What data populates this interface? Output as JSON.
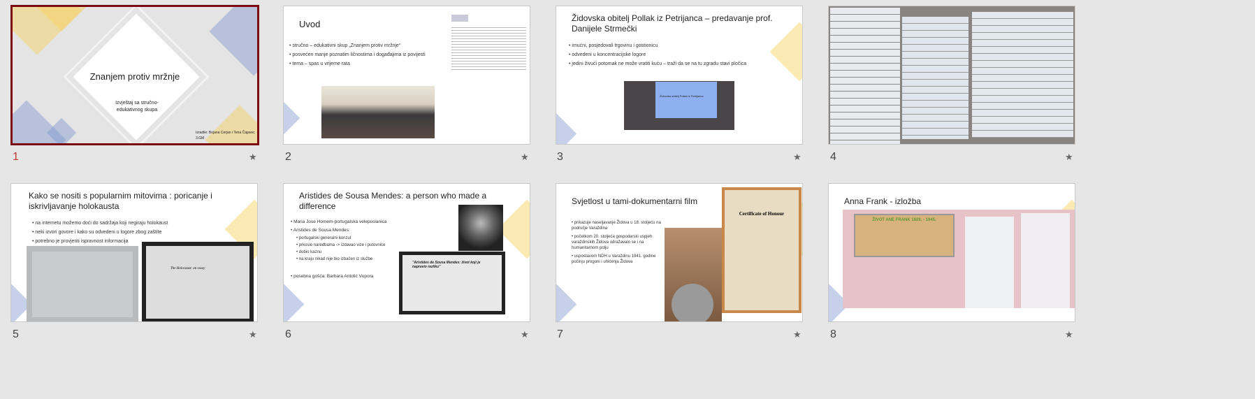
{
  "slides": [
    {
      "number": "1",
      "title": "Znanjem protiv mržnje",
      "subtitle": "Izvještaj sa stručno-edukativnog skupa",
      "authors": "Izradile: Bojana Cerjan i Tena Čajavec",
      "class": "3.GM",
      "selected": true
    },
    {
      "number": "2",
      "title": "Uvod",
      "bullets": [
        "stručno – edukativni skup „Znanjem protiv mržnje“",
        "posvećen manje poznatim ličnostima i događajima iz povijesti",
        "tema – spas u vrijeme rata"
      ]
    },
    {
      "number": "3",
      "title": "Židovska obitelj Pollak iz Petrijanca – predavanje prof. Danijele Strmečki",
      "bullets": [
        "imućni, posjedovali trgovinu i gostionicu",
        "odvedeni u koncentracijske logore",
        "jedini živući potomak ne može vratiti kuću – traži da se na tu zgradu stavi pločica"
      ],
      "screen_text": "Židovska obitelj Pollak iz Petrijanca"
    },
    {
      "number": "4"
    },
    {
      "number": "5",
      "title": "Kako se nositi s popularnim mitovima : poricanje i iskrivljavanje holokausta",
      "bullets": [
        "na internetu možemo doći do sadržaja koji negiraju holokaust",
        "neki izvori govore i kako su odvedeni u logore zbog zaštite",
        "potrebno je provjeriti ispravnost informacija"
      ],
      "screen_text": "The Holocaust: an essay"
    },
    {
      "number": "6",
      "title": "Aristides de Sousa Mendes: a person who made a difference",
      "bullets": [
        "Maria Jose Homem-portugalska veleposlanica",
        "Aristides de Sousa Mendes:"
      ],
      "sub_bullets": [
        "portugalski generalni konzul",
        "prkosio naredbama -> izdavao vize i putovnice",
        "dobio kaznu",
        "na kraju nikad nije bio izbačen iz službe"
      ],
      "last_bullet": "posebna gošća: Barbara Antolić Vupora",
      "screen_text": "\"Aristides de Sousa Mendes: život koji je napravio razliku\""
    },
    {
      "number": "7",
      "title": "Svjetlost u tami-dokumentarni film",
      "bullets": [
        "prikazuje naseljavanje Židova u 18. stoljeću na područje Varaždina",
        "početkom 20. stoljeća gospodarski uspjeh varaždinskih Židova odražavalo se i na humanitarnom polju",
        "uspostavom NDH u Varaždinu 1941. godine počinju progoni i uhićenja Židova"
      ],
      "certificate_text": "Certificate of Honour"
    },
    {
      "number": "8",
      "title": "Anna Frank - izložba",
      "board_text": "ŽIVOT ANE FRANK 1929. - 1945."
    }
  ],
  "star_icon": "star-icon"
}
